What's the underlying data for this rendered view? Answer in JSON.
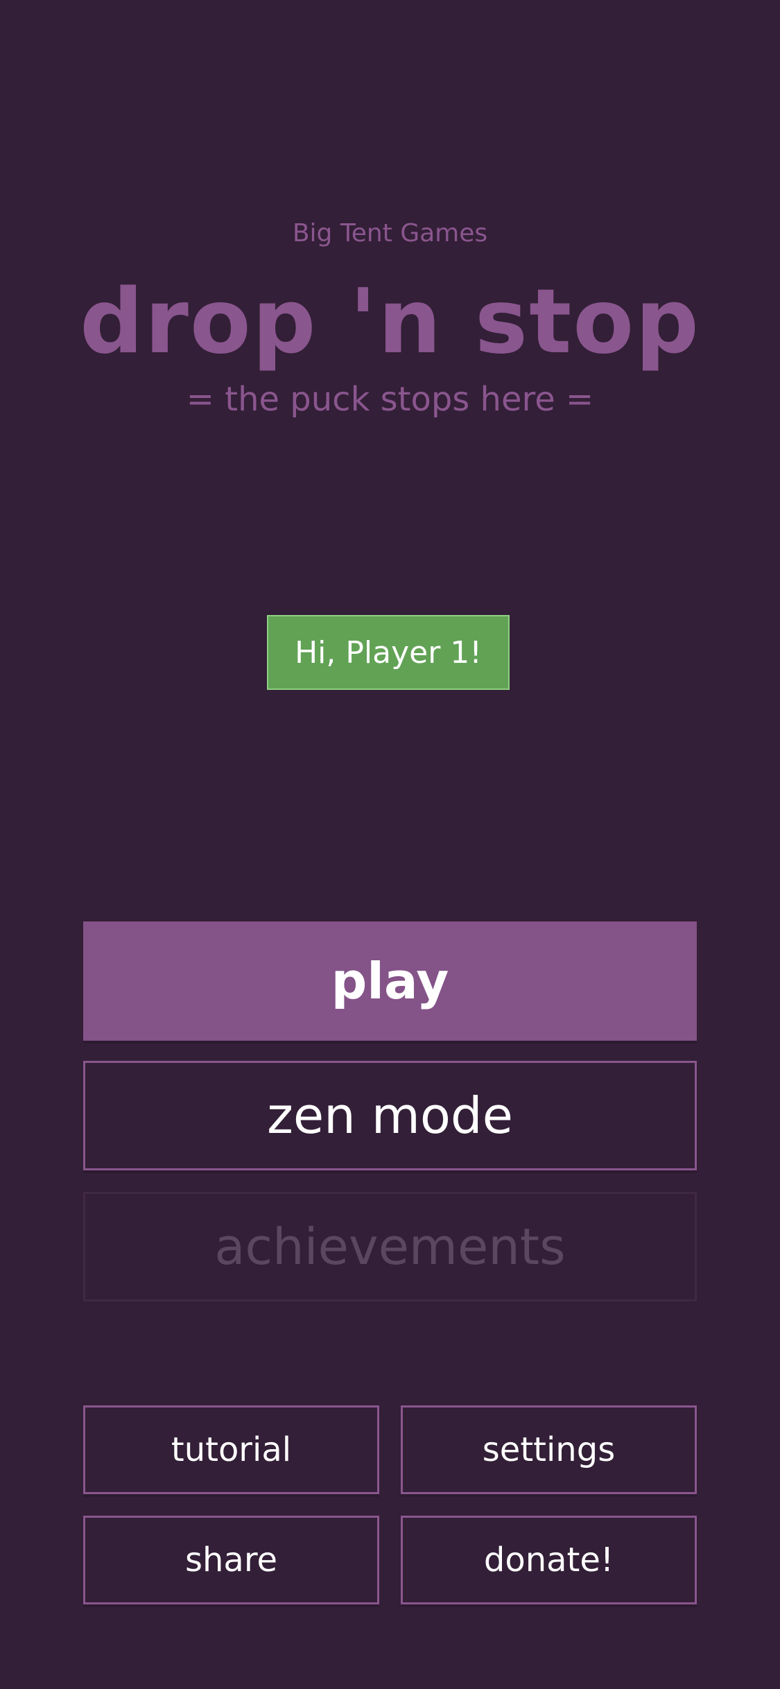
{
  "header": {
    "publisher": "Big Tent Games",
    "title": "drop 'n stop",
    "tagline": "= the puck stops here ="
  },
  "greeting": {
    "text": "Hi, Player 1!"
  },
  "menu": {
    "play_label": "play",
    "zen_label": "zen mode",
    "achievements_label": "achievements",
    "tutorial_label": "tutorial",
    "settings_label": "settings",
    "share_label": "share",
    "donate_label": "donate!"
  },
  "colors": {
    "background": "#331f37",
    "accent": "#845388",
    "title_text": "#8a568e",
    "greeting_bg": "#61a255",
    "disabled_text": "#5b4760"
  }
}
